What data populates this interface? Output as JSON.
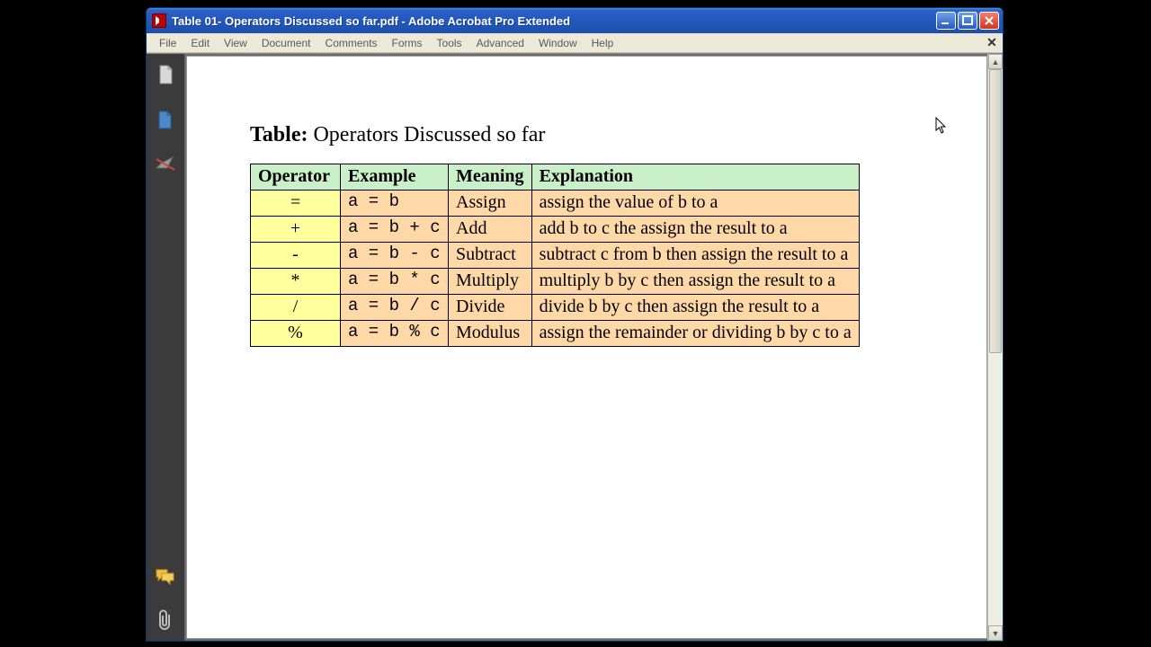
{
  "window": {
    "title": "Table 01- Operators Discussed so far.pdf - Adobe Acrobat Pro Extended"
  },
  "menu": {
    "items": [
      "File",
      "Edit",
      "View",
      "Document",
      "Comments",
      "Forms",
      "Tools",
      "Advanced",
      "Window",
      "Help"
    ]
  },
  "document": {
    "title_label": "Table:",
    "title_text": "Operators Discussed so far",
    "headers": [
      "Operator",
      "Example",
      "Meaning",
      "Explanation"
    ],
    "rows": [
      {
        "op": "=",
        "ex": "a = b",
        "me": "Assign",
        "expl": "assign the value of b to a"
      },
      {
        "op": "+",
        "ex": "a = b + c",
        "me": "Add",
        "expl": "add b to c the assign the result to a"
      },
      {
        "op": "-",
        "ex": "a = b - c",
        "me": "Subtract",
        "expl": "subtract c from b then assign the result to a"
      },
      {
        "op": "*",
        "ex": "a = b * c",
        "me": "Multiply",
        "expl": "multiply b by c then assign the result to a"
      },
      {
        "op": "/",
        "ex": "a = b / c",
        "me": "Divide",
        "expl": "divide b by c then assign the result to a"
      },
      {
        "op": "%",
        "ex": "a = b % c",
        "me": "Modulus",
        "expl": "assign the remainder or dividing b by c to a"
      }
    ]
  }
}
